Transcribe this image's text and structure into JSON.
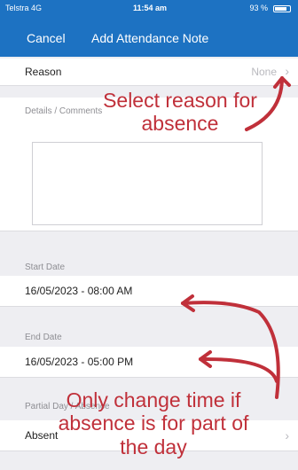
{
  "status_bar": {
    "carrier": "Telstra 4G",
    "time": "11:54 am",
    "battery": "93 %"
  },
  "nav": {
    "cancel_label": "Cancel",
    "title": "Add Attendance Note"
  },
  "form": {
    "reason": {
      "label": "Reason",
      "value": "None"
    },
    "details": {
      "label": "Details / Comments",
      "value": ""
    },
    "start_date": {
      "label": "Start Date",
      "value": "16/05/2023 - 08:00 AM"
    },
    "end_date": {
      "label": "End Date",
      "value": "16/05/2023 - 05:00 PM"
    },
    "extra": {
      "label": "Partial Day / Absence",
      "value": "Absent"
    }
  },
  "annotations": {
    "reason_line1": "Select reason for",
    "reason_line2": "absence",
    "time_line1": "Only change time if",
    "time_line2": "absence is for part of",
    "time_line3": "the day"
  },
  "colors": {
    "brand": "#1d72c2",
    "annotation": "#c0303a"
  }
}
